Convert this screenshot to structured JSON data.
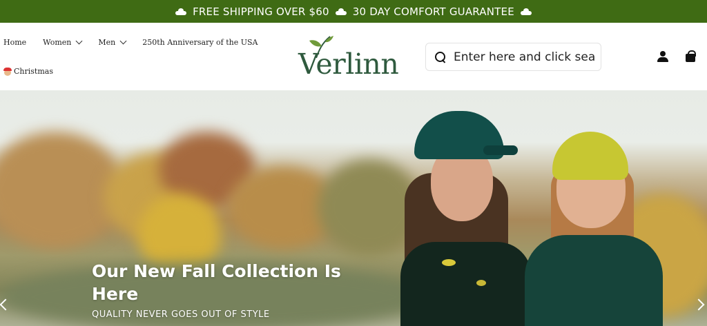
{
  "announcement": {
    "shipping": "FREE SHIPPING OVER $60",
    "guarantee": "30 DAY COMFORT GUARANTEE",
    "icon": "cloud-icon"
  },
  "nav": {
    "items": [
      {
        "label": "Home"
      },
      {
        "label": "Women"
      },
      {
        "label": "Men"
      },
      {
        "label": "250th Anniversary of the USA"
      },
      {
        "label": "Christmas"
      }
    ]
  },
  "logo": {
    "text": "Verlinn"
  },
  "search": {
    "placeholder": "Enter here and click sea"
  },
  "hero": {
    "title": "Our New Fall Collection Is Here",
    "subtitle": "QUALITY NEVER GOES OUT OF STYLE"
  },
  "colors": {
    "announcement_bg": "#3f6b14",
    "logo_green": "#2f5a3e"
  }
}
